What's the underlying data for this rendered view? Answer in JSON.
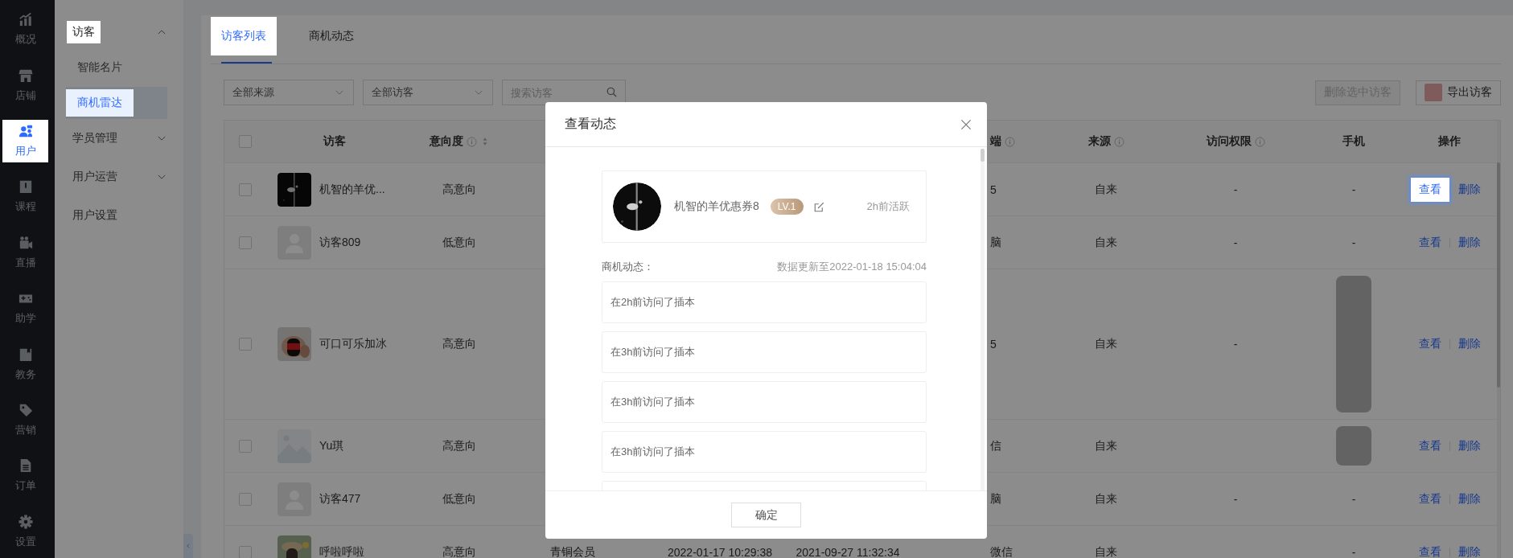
{
  "nav": [
    {
      "label": "概况",
      "selected": false
    },
    {
      "label": "店铺",
      "selected": false
    },
    {
      "label": "用户",
      "selected": true
    },
    {
      "label": "课程",
      "selected": false
    },
    {
      "label": "直播",
      "selected": false
    },
    {
      "label": "助学",
      "selected": false
    },
    {
      "label": "教务",
      "selected": false
    },
    {
      "label": "营销",
      "selected": false
    },
    {
      "label": "订单",
      "selected": false
    },
    {
      "label": "设置",
      "selected": false
    }
  ],
  "sidebar": {
    "items": [
      {
        "label": "访客",
        "expanded": true,
        "highlighted": true,
        "children": [
          {
            "label": "智能名片",
            "selected": false
          },
          {
            "label": "商机雷达",
            "selected": true
          }
        ]
      },
      {
        "label": "学员管理",
        "expanded": false,
        "highlighted": false
      },
      {
        "label": "用户运营",
        "expanded": false,
        "highlighted": false
      },
      {
        "label": "用户设置",
        "highlighted": false
      }
    ]
  },
  "tabs": [
    {
      "label": "访客列表",
      "selected": true
    },
    {
      "label": "商机动态",
      "selected": false
    }
  ],
  "filters": {
    "source": {
      "value": "全部来源"
    },
    "visitor_type": {
      "value": "全部访客"
    },
    "search": {
      "placeholder": "搜索访客"
    }
  },
  "toolbar": {
    "buttons": [
      {
        "label": "删除选中访客",
        "disabled": true,
        "kind": "plain"
      },
      {
        "label": "导出访客",
        "disabled": false,
        "kind": "icon"
      }
    ]
  },
  "table": {
    "select_all": {
      "checked": false
    },
    "columns": [
      {
        "label": "访客"
      },
      {
        "label": "意向度",
        "info": true,
        "sortable": true
      },
      {
        "label": "端",
        "info": true
      },
      {
        "label": "来源",
        "info": true
      },
      {
        "label": "访问权限",
        "info": true
      },
      {
        "label": "手机"
      },
      {
        "label": "操作"
      }
    ],
    "rows": [
      {
        "checked": false,
        "tall": false,
        "name": "机智的羊优...",
        "intent": "高意向",
        "terminal": "5",
        "source": "自来",
        "permission": "-",
        "phone": "-",
        "actions": [
          {
            "label": "查看",
            "highlighted": true
          },
          {
            "label": "删除",
            "highlighted": false
          }
        ]
      },
      {
        "checked": false,
        "tall": false,
        "avatar": {
          "kind": "default"
        },
        "name": "访客809",
        "intent": "低意向",
        "terminal": "脑",
        "source": "自来",
        "permission": "-",
        "phone": "-",
        "actions": [
          {
            "label": "查看",
            "highlighted": false
          },
          {
            "label": "删除",
            "highlighted": false
          }
        ]
      },
      {
        "checked": false,
        "tall": true,
        "name": "可口可乐加冰",
        "intent": "高意向",
        "terminal": "5",
        "source": "自来",
        "permission": "-",
        "phone_blurred": true,
        "actions": [
          {
            "label": "查看",
            "highlighted": false
          },
          {
            "label": "删除",
            "highlighted": false
          }
        ]
      },
      {
        "checked": false,
        "tall": false,
        "avatar": {
          "kind": "placeholder"
        },
        "name": "Yu琪",
        "intent": "高意向",
        "terminal": "信",
        "source": "自来",
        "phone_blurred": true,
        "actions": [
          {
            "label": "查看",
            "highlighted": false
          },
          {
            "label": "删除",
            "highlighted": false
          }
        ]
      },
      {
        "checked": false,
        "tall": false,
        "avatar": {
          "kind": "default"
        },
        "name": "访客477",
        "intent": "低意向",
        "terminal": "脑",
        "source": "自来",
        "permission": "-",
        "phone": "-",
        "actions": [
          {
            "label": "查看",
            "highlighted": false
          },
          {
            "label": "删除",
            "highlighted": false
          }
        ]
      },
      {
        "checked": false,
        "tall": false,
        "name": "呼啦呼啦",
        "intent": "高意向",
        "member": "青铜会员",
        "last_visit": "2022-01-17 10:29:38",
        "first_visit": "2021-09-27 11:32:34",
        "terminal": "微信",
        "source": "自来",
        "phone": "-",
        "actions": [
          {
            "label": "查看",
            "highlighted": false
          },
          {
            "label": "删除",
            "highlighted": false
          }
        ]
      }
    ]
  },
  "modal": {
    "title": "查看动态",
    "profile": {
      "name": "机智的羊优惠券8",
      "badge": "LV.1",
      "active": "2h前活跃"
    },
    "section_title": "商机动态：",
    "updated": "数据更新至2022-01-18 15:04:04",
    "activities": [
      "在2h前访问了插本",
      "在3h前访问了插本",
      "在3h前访问了插本",
      "在3h前访问了插本"
    ],
    "confirm": "确定"
  }
}
